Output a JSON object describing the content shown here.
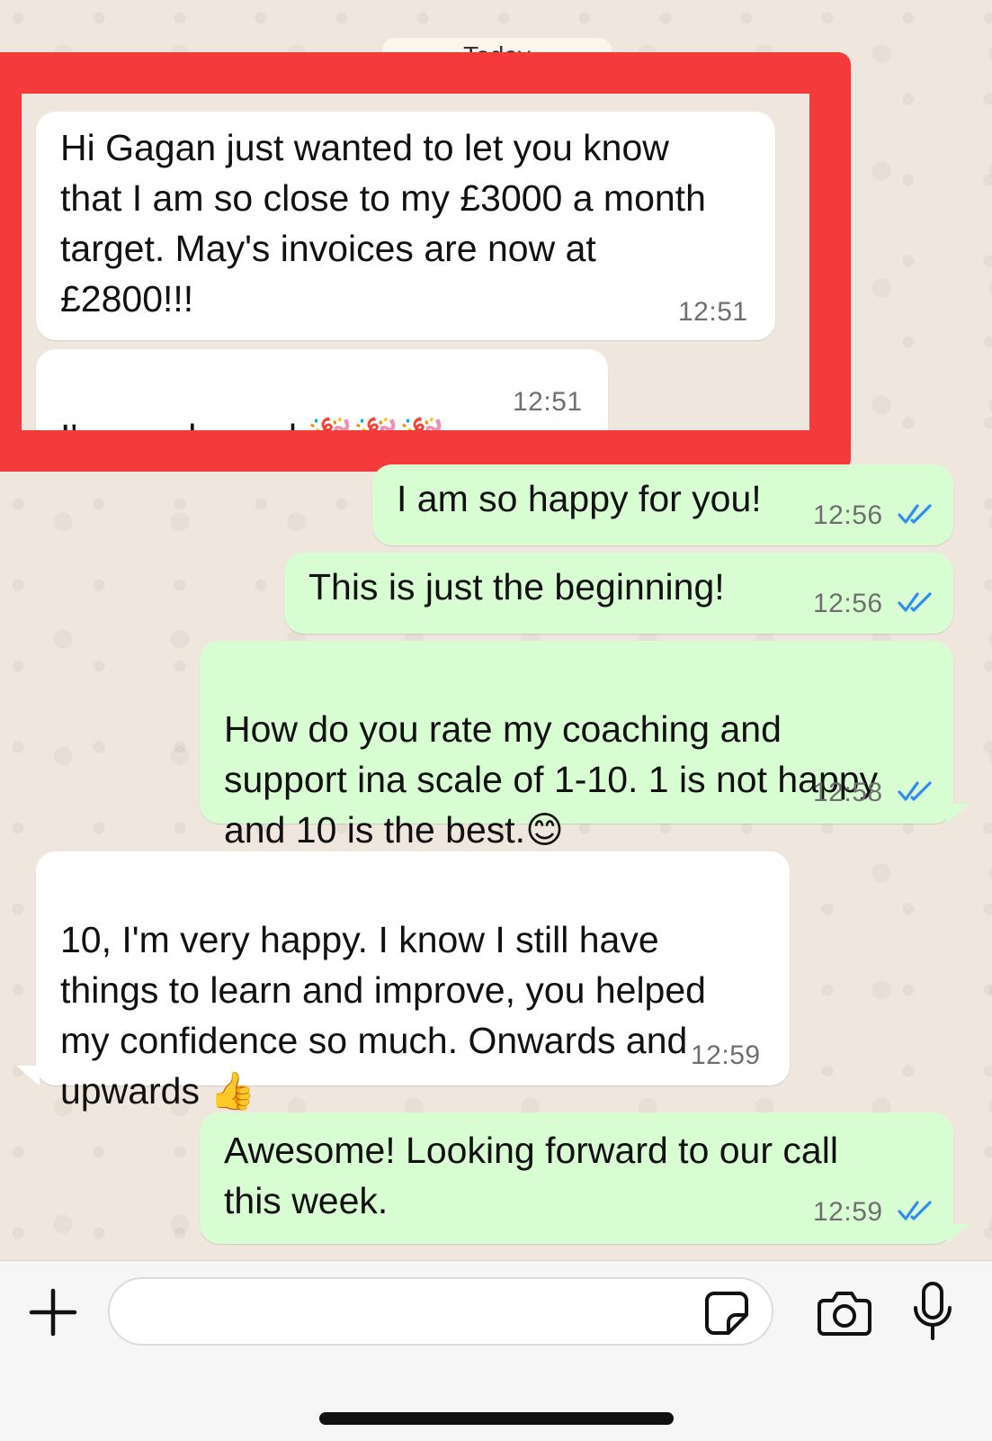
{
  "chat": {
    "date_label": "Today",
    "messages": [
      {
        "direction": "in",
        "text": "Hi Gagan just wanted to let you know\nthat I am so close to my £3000 a month\ntarget. May's invoices are now at\n£2800!!!",
        "time": "12:51"
      },
      {
        "direction": "in",
        "text": "I'm so pleased ",
        "emoji": "🎉🎉🎉",
        "time": "12:51"
      },
      {
        "direction": "out",
        "text": "I am so happy for you!",
        "time": "12:56",
        "status": "read"
      },
      {
        "direction": "out",
        "text": "This is just the beginning!",
        "time": "12:56",
        "status": "read"
      },
      {
        "direction": "out",
        "text": "How do you rate my coaching and\nsupport ina scale of 1-10. 1 is not happy\nand 10 is the best.",
        "emoji": "😊",
        "time": "12:58",
        "status": "read"
      },
      {
        "direction": "in",
        "text": "10, I'm very happy. I know I still have\nthings to learn and improve, you helped\nmy confidence so much. Onwards and\nupwards ",
        "emoji": "👍",
        "time": "12:59"
      },
      {
        "direction": "out",
        "text": "Awesome! Looking forward to our call\nthis week.",
        "time": "12:59",
        "status": "read"
      }
    ]
  },
  "input_bar": {
    "placeholder": "",
    "icons": [
      "plus-icon",
      "sticker-icon",
      "camera-icon",
      "microphone-icon"
    ]
  },
  "colors": {
    "chat_background": "#efe7dd",
    "incoming_bubble": "#ffffff",
    "outgoing_bubble": "#d9fdd3",
    "read_ticks": "#2f8cf0",
    "highlight_box": "#f43a3a"
  }
}
